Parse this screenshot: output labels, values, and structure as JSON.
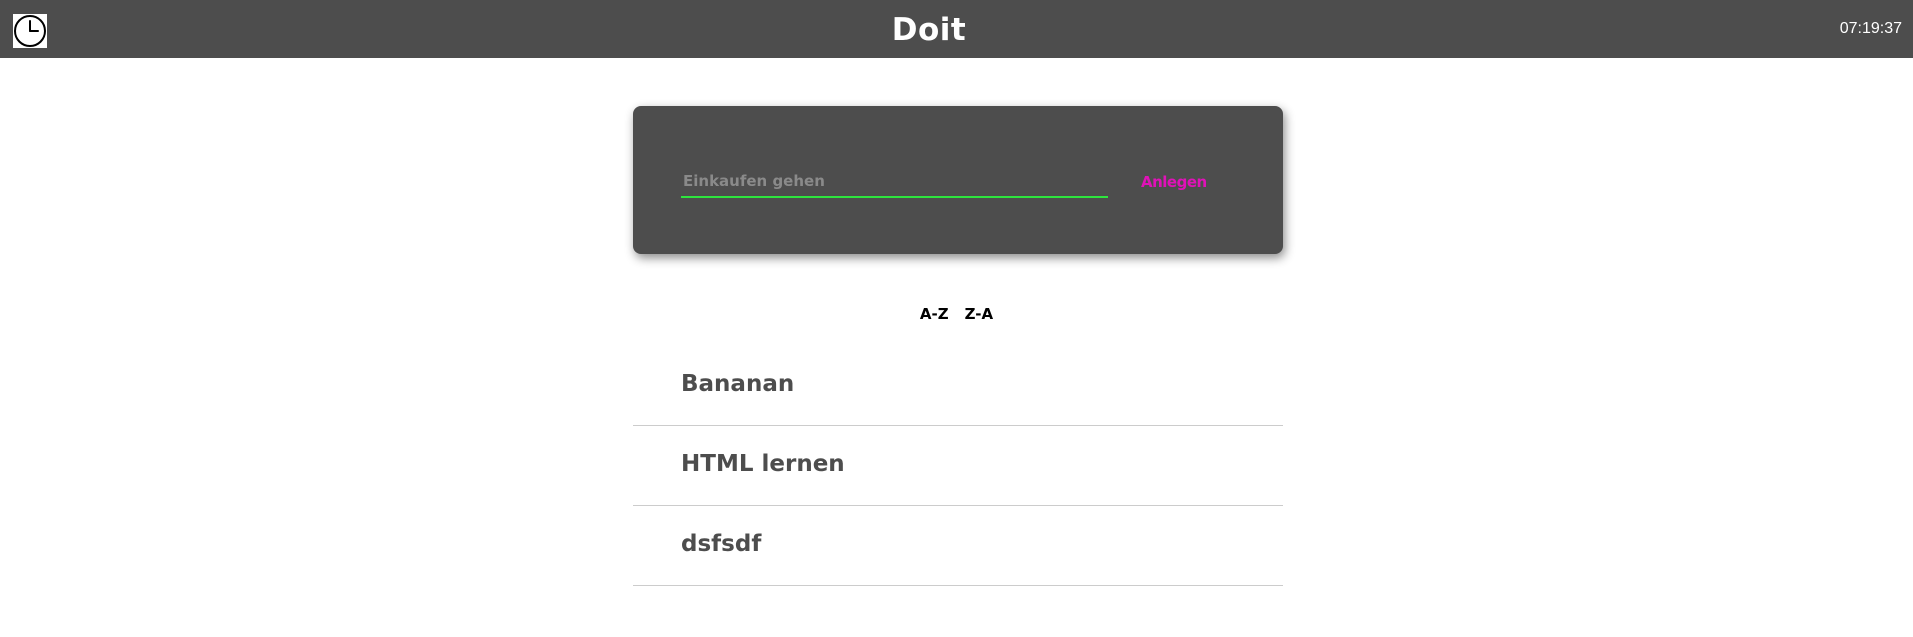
{
  "header": {
    "title": "Doit",
    "time": "07:19:37",
    "clock_icon": "clock-icon",
    "background_color": "#4d4d4d"
  },
  "new_task": {
    "placeholder": "Einkaufen gehen",
    "value": "",
    "submit_label": "Anlegen",
    "accent_color": "#e012b8",
    "underline_color": "#2ee53e"
  },
  "sort": {
    "asc_label": "A-Z",
    "desc_label": "Z-A"
  },
  "todos": [
    {
      "label": "Bananan"
    },
    {
      "label": "HTML lernen"
    },
    {
      "label": "dsfsdf"
    }
  ]
}
